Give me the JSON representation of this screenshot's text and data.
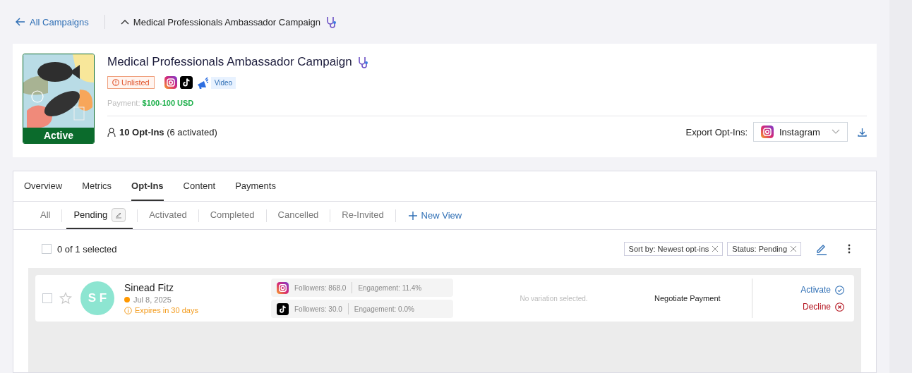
{
  "breadcrumb": {
    "back_label": "All Campaigns",
    "title": "Medical Professionals Ambassador Campaign"
  },
  "campaign": {
    "title": "Medical Professionals Ambassador Campaign",
    "status": "Active",
    "visibility": "Unlisted",
    "platforms": [
      {
        "kind": "instagram"
      },
      {
        "kind": "tiktok"
      },
      {
        "kind": "promo"
      }
    ],
    "content_type": "Video",
    "payment_label": "Payment:",
    "payment_value": "$100-100 USD",
    "opt_ins_count": "10 Opt-Ins",
    "opt_ins_activated": "(6 activated)",
    "export_label": "Export Opt-Ins:",
    "export_platform": {
      "kind": "instagram",
      "label": "Instagram"
    }
  },
  "tabs": [
    {
      "label": "Overview",
      "selected": false
    },
    {
      "label": "Metrics",
      "selected": false
    },
    {
      "label": "Opt-Ins",
      "selected": true
    },
    {
      "label": "Content",
      "selected": false
    },
    {
      "label": "Payments",
      "selected": false
    }
  ],
  "views": [
    {
      "label": "All",
      "selected": false,
      "editable": false
    },
    {
      "label": "Pending",
      "selected": true,
      "editable": true
    },
    {
      "label": "Activated",
      "selected": false,
      "editable": false
    },
    {
      "label": "Completed",
      "selected": false,
      "editable": false
    },
    {
      "label": "Cancelled",
      "selected": false,
      "editable": false
    },
    {
      "label": "Re-Invited",
      "selected": false,
      "editable": false
    }
  ],
  "new_view": "New View",
  "selection": {
    "label": "0 of 1 selected",
    "checked": false
  },
  "filters": [
    "Sort by: Newest opt-ins",
    "Status: Pending"
  ],
  "opt_ins": [
    {
      "initials": "S F",
      "name": "Sinead Fitz",
      "date": "Jul 8, 2025",
      "color": "#ff9800",
      "expiry": "Expires in 30 days",
      "starred": false,
      "checked": false,
      "socials": [
        {
          "kind": "instagram",
          "followers": "Followers: 868.0",
          "engagement": "Engagement: 11.4%"
        },
        {
          "kind": "tiktok",
          "followers": "Followers: 30.0",
          "engagement": "Engagement: 0.0%"
        }
      ],
      "variation": "No variation selected.",
      "payment": "Negotiate Payment",
      "actions": [
        {
          "kind": "activate",
          "label": "Activate"
        },
        {
          "kind": "decline",
          "label": "Decline"
        }
      ]
    }
  ]
}
